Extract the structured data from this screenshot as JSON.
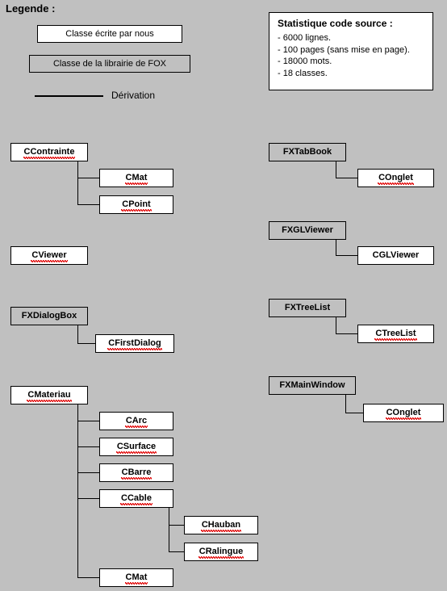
{
  "legend": {
    "title": "Legende :",
    "own_class_label": "Classe écrite par nous",
    "fox_class_label": "Classe de la librairie de FOX",
    "derivation_label": "Dérivation"
  },
  "stats": {
    "title": "Statistique code source :",
    "items": [
      "- 6000 lignes.",
      "- 100 pages (sans mise en page).",
      "- 18000 mots.",
      "- 18 classes."
    ]
  },
  "colors": {
    "background": "#c0c0c0",
    "own_class_fill": "#ffffff",
    "fox_class_fill": "#c0c0c0",
    "border": "#000000",
    "spellcheck_underline": "#e00000"
  },
  "classes": {
    "ccontrainte": "CContrainte",
    "cmat_top": "CMat",
    "cpoint": "CPoint",
    "cviewer": "CViewer",
    "fxdialogbox": "FXDialogBox",
    "cfirstdialog": "CFirstDialog",
    "cmateriau": "CMateriau",
    "carc": "CArc",
    "csurface": "CSurface",
    "cbarre": "CBarre",
    "ccable": "CCable",
    "chauban": "CHauban",
    "cralingue": "CRalingue",
    "cmat_bottom": "CMat",
    "fxtabbook": "FXTabBook",
    "conglet_top": "COnglet",
    "fxglviewer": "FXGLViewer",
    "cglviewer": "CGLViewer",
    "fxtreelist": "FXTreeList",
    "ctreelist": "CTreeList",
    "fxmainwindow": "FXMainWindow",
    "conglet_bottom": "COnglet"
  }
}
